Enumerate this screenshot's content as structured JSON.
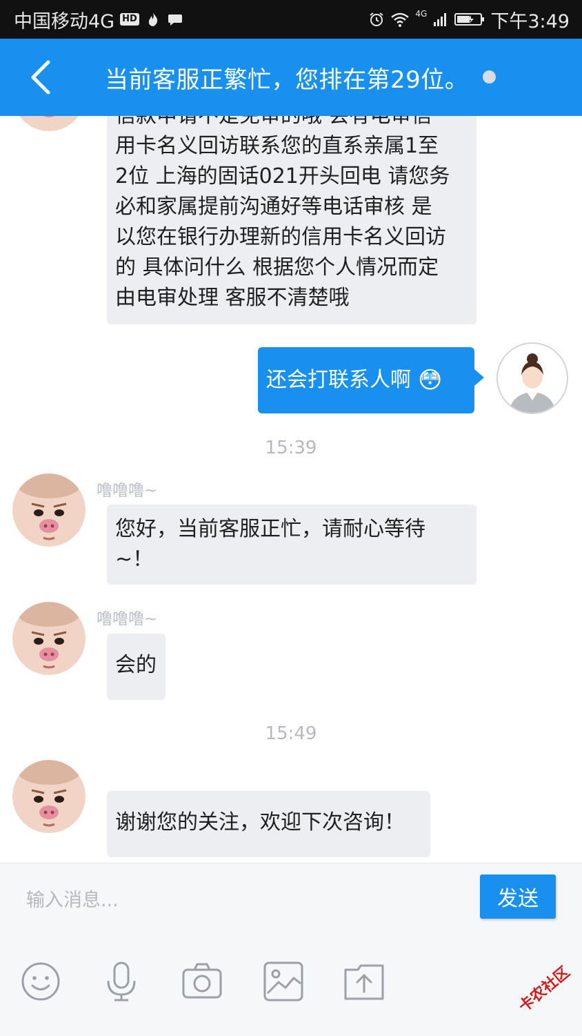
{
  "status_bar": {
    "carrier": "中国移动4G",
    "hd_badge": "HD",
    "network": "4G",
    "time": "下午3:49"
  },
  "header": {
    "title": "当前客服正繁忙，您排在第29位。"
  },
  "messages": {
    "m1": {
      "sender": "agent",
      "lines": [
        "信款申请不是免审的哦 会有电审信",
        "用卡名义回访联系您的直系亲属1至",
        "2位 上海的固话021开头回电 请您务",
        "必和家属提前沟通好等电话审核 是",
        "以您在银行办理新的信用卡名义回访",
        "的 具体问什么 根据您个人情况而定",
        "由电审处理 客服不清楚哦"
      ]
    },
    "m2": {
      "sender": "user",
      "text": "还会打联系人啊",
      "emoji": "😳"
    },
    "ts1": "15:39",
    "m3": {
      "sender": "agent",
      "name": "噜噜噜~",
      "lines": [
        "您好，当前客服正忙，请耐心等待",
        "~！"
      ]
    },
    "m4": {
      "sender": "agent",
      "name": "噜噜噜~",
      "text": "会的"
    },
    "ts2": "15:49",
    "m5": {
      "sender": "agent",
      "text": "谢谢您的关注，欢迎下次咨询！"
    }
  },
  "input_bar": {
    "placeholder": "输入消息...",
    "send_label": "发送",
    "tools": [
      "emoji-icon",
      "microphone-icon",
      "camera-icon",
      "image-icon",
      "upload-icon"
    ]
  },
  "watermark": "卡农社区",
  "colors": {
    "primary": "#1a90ee",
    "incoming_bubble": "#eceef1",
    "timestamp": "#b5b9bf"
  }
}
